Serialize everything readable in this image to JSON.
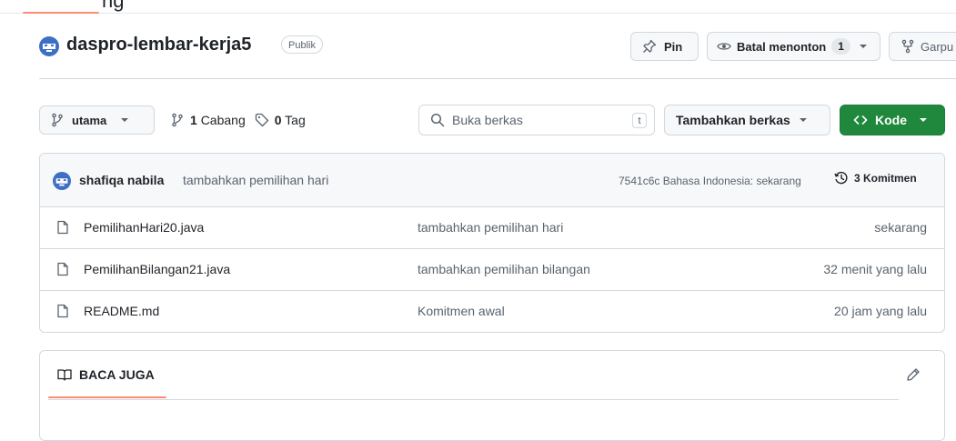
{
  "top": {
    "partial_label": "ng"
  },
  "repo": {
    "name": "daspro-lembar-kerja5",
    "visibility": "Publik",
    "pin_label": "Pin",
    "watch_label": "Batal menonton",
    "watch_count": "1",
    "fork_label": "Garpu"
  },
  "toolbar": {
    "branch": "utama",
    "branch_count": "1",
    "branch_word": "Cabang",
    "tag_count": "0",
    "tag_word": "Tag",
    "search_placeholder": "Buka berkas",
    "search_key": "t",
    "add_file_label": "Tambahkan berkas",
    "code_label": "Kode"
  },
  "commit": {
    "author": "shafiqa nabila",
    "message": "tambahkan pemilihan hari",
    "meta": "7541c6c Bahasa Indonesia: sekarang",
    "commits_label": "3 Komitmen"
  },
  "files": [
    {
      "name": "PemilihanHari20.java",
      "message": "tambahkan pemilihan hari",
      "time": "sekarang"
    },
    {
      "name": "PemilihanBilangan21.java",
      "message": "tambahkan pemilihan bilangan",
      "time": "32 menit yang lalu"
    },
    {
      "name": "README.md",
      "message": "Komitmen awal",
      "time": "20 jam yang lalu"
    }
  ],
  "readme": {
    "tab_label": "BACA JUGA"
  },
  "colors": {
    "accent_orange": "#fd8c73",
    "code_green": "#1f883d",
    "border": "#d1d9e0",
    "muted_text": "#59636e"
  },
  "icons": [
    "repo-avatar-icon",
    "pin-icon",
    "eye-icon",
    "fork-icon",
    "branch-icon",
    "tag-icon",
    "search-icon",
    "code-icon",
    "history-icon",
    "file-icon",
    "book-icon",
    "pencil-icon"
  ]
}
